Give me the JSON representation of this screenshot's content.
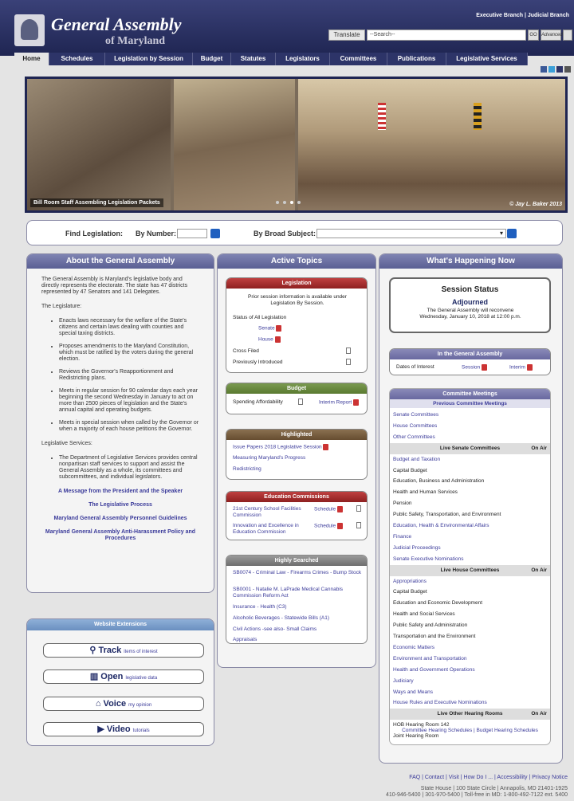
{
  "header": {
    "title_main": "General Assembly",
    "title_sub": "of Maryland",
    "top_links": "Executive Branch  |  Judicial Branch",
    "translate": "Translate",
    "search_placeholder": "--Search--",
    "search_btn": "GO",
    "advanced_btn": "Advanced"
  },
  "nav": [
    {
      "label": "Home"
    },
    {
      "label": "Schedules"
    },
    {
      "label": "Legislation by Session"
    },
    {
      "label": "Budget"
    },
    {
      "label": "Statutes"
    },
    {
      "label": "Legislators"
    },
    {
      "label": "Committees"
    },
    {
      "label": "Publications"
    },
    {
      "label": "Legislative Services"
    }
  ],
  "banner": {
    "caption": "Bill Room Staff Assembling Legislation Packets",
    "credit": "© Jay L. Baker 2013"
  },
  "find": {
    "label": "Find Legislation:",
    "by_number": "By Number:",
    "by_subject": "By Broad Subject:"
  },
  "about": {
    "heading": "About the General Assembly",
    "intro": "The General Assembly is Maryland's legislative body and directly represents the electorate. The state has 47 districts represented by 47 Senators and 141 Delegates.",
    "legislature_label": "The Legislature:",
    "bullets": [
      "Enacts laws necessary for the welfare of the State's citizens and certain laws dealing with counties and special taxing districts.",
      "Proposes amendments to the Maryland Constitution, which must be ratified by the voters during the general election.",
      "Reviews the Governor's Reapportionment and Redistricting plans.",
      "Meets in regular session for 90 calendar days each year beginning the second Wednesday in January to act on more than 2500 pieces of legislation and the State's annual capital and operating budgets.",
      "Meets in special session when called by the Governor or when a majority of each house petitions the Governor."
    ],
    "services_label": "Legislative Services:",
    "services_text": "The Department of Legislative Services provides central nonpartisan staff services to support and assist the General Assembly as a whole, its committees and subcommittees, and individual legislators.",
    "links": [
      "A Message from the President and the Speaker",
      "The Legislative Process",
      "Maryland General Assembly Personnel Guidelines",
      "Maryland General Assembly Anti-Harassment Policy and Procedures"
    ]
  },
  "extensions": {
    "heading": "Website Extensions",
    "items": [
      {
        "big": "Track",
        "small": "items of interest"
      },
      {
        "big": "Open",
        "small": "legislative data"
      },
      {
        "big": "Voice",
        "small": "my opinion"
      },
      {
        "big": "Video",
        "small": "tutorials"
      }
    ]
  },
  "topics": {
    "heading": "Active Topics",
    "legislation": {
      "title": "Legislation",
      "note": "Prior session information is available under Legislation By Session.",
      "status": "Status of All Legislation",
      "senate": "Senate",
      "house": "House",
      "cross": "Cross Filed",
      "prev": "Previously Introduced"
    },
    "budget": {
      "title": "Budget",
      "spending": "Spending Affordability",
      "interim": "Interim Report"
    },
    "highlighted": {
      "title": "Highlighted",
      "items": [
        "Issue Papers 2018 Legislative Session",
        "Measuring Maryland's Progress",
        "Redistricting"
      ]
    },
    "education": {
      "title": "Education Commissions",
      "items": [
        {
          "name": "21st Century School Facilities Commission",
          "sched": "Schedule"
        },
        {
          "name": "Innovation and Excellence in Education Commission",
          "sched": "Schedule"
        }
      ]
    },
    "searched": {
      "title": "Highly Searched",
      "items": [
        "SB0074 - Criminal Law - Firearms Crimes - Bump Stock",
        "SB0001 - Natalie M. LaPrade Medical Cannabis Commission Reform Act",
        "Insurance - Health (C3)",
        "Alcoholic Beverages - Statewide Bills (A1)",
        "Civil Actions -see also- Small Claims",
        "Appraisals"
      ]
    }
  },
  "happening": {
    "heading": "What's Happening Now",
    "session_title": "Session Status",
    "session_state": "Adjourned",
    "session_note": "The General Assembly will reconvene Wednesday, January 10, 2018 at 12:00 p.m.",
    "inga_title": "In the General Assembly",
    "dates_label": "Dates of Interest",
    "session_link": "Session",
    "interim_link": "Interim",
    "cm_title": "Committee Meetings",
    "prev_meetings": "Previous Committee Meetings",
    "links": [
      "Senate Committees",
      "House Committees",
      "Other Committees"
    ],
    "live_senate": "Live Senate Committees",
    "on_air": "On Air",
    "senate_items": [
      {
        "t": "Budget and Taxation",
        "sub": false
      },
      {
        "t": "Capital Budget",
        "sub": true
      },
      {
        "t": "Education, Business and Administration",
        "sub": true
      },
      {
        "t": "Health and Human Services",
        "sub": true
      },
      {
        "t": "Pension",
        "sub": true
      },
      {
        "t": "Public Safety, Transportation, and Environment",
        "sub": true
      },
      {
        "t": "Education, Health & Environmental Affairs",
        "sub": false
      },
      {
        "t": "Finance",
        "sub": false
      },
      {
        "t": "Judicial Proceedings",
        "sub": false
      },
      {
        "t": "Senate Executive Nominations",
        "sub": false
      }
    ],
    "live_house": "Live House Committees",
    "house_items": [
      {
        "t": "Appropriations",
        "sub": false
      },
      {
        "t": "Capital Budget",
        "sub": true
      },
      {
        "t": "Education and Economic Development",
        "sub": true
      },
      {
        "t": "Health and Social Services",
        "sub": true
      },
      {
        "t": "Public Safety and Administration",
        "sub": true
      },
      {
        "t": "Transportation and the Environment",
        "sub": true
      },
      {
        "t": "Economic Matters",
        "sub": false
      },
      {
        "t": "Environment and Transportation",
        "sub": false
      },
      {
        "t": "Health and Government Operations",
        "sub": false
      },
      {
        "t": "Judiciary",
        "sub": false
      },
      {
        "t": "Ways and Means",
        "sub": false
      },
      {
        "t": "House Rules and Executive Nominations",
        "sub": false
      }
    ],
    "live_other": "Live Other Hearing Rooms",
    "other_items": [
      {
        "t": "HOB Hearing Room 142",
        "sub": false
      },
      {
        "t": "Joint Hearing Room",
        "sub": false
      }
    ],
    "footer_links": "Committee Hearing Schedules | Budget Hearing Schedules"
  },
  "footer": {
    "links": "FAQ  |  Contact  |  Visit  |  How Do I ...  |  Accessibility  |  Privacy Notice",
    "address": "State House  |  100 State Circle  |  Annapolis, MD 21401-1925",
    "phones": "410-946-5400  |  301-970-5400  |  Toll-free in MD: 1-800-492-7122 ext. 5400"
  }
}
